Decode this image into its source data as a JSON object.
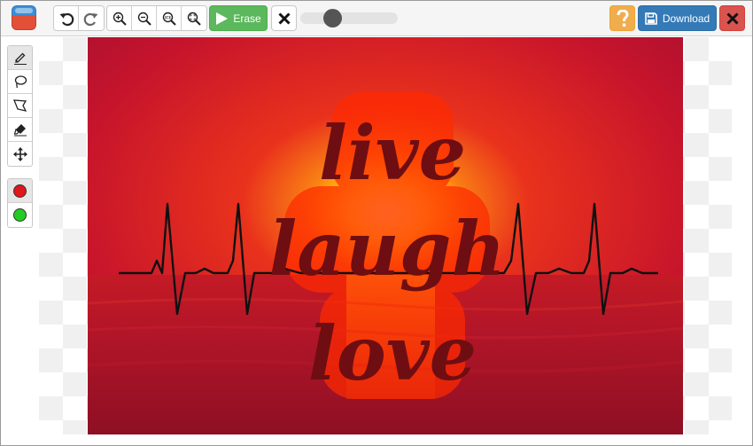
{
  "toolbar": {
    "erase_label": "Erase",
    "download_label": "Download",
    "brush_size": 0.33,
    "buttons": {
      "undo": "undo-icon",
      "redo": "redo-icon",
      "zoom_in": "zoom-in-icon",
      "zoom_out": "zoom-out-icon",
      "zoom_actual": "zoom-actual-size-icon",
      "zoom_fit": "zoom-fit-icon",
      "clear": "close-icon",
      "help": "question-mark-icon",
      "download": "save-icon",
      "close": "close-icon"
    },
    "colors": {
      "erase": "#5cb85c",
      "help": "#f0ad4e",
      "download": "#337ab7",
      "close": "#d9534f"
    }
  },
  "palette": {
    "tools": [
      "marker-icon",
      "lasso-icon",
      "polygon-lasso-icon",
      "eraser-icon",
      "move-icon"
    ],
    "active_tool": "marker-icon",
    "colors": [
      "#e0171b",
      "#22cc22"
    ]
  },
  "canvas": {
    "image_text": [
      "live",
      "laugh",
      "love"
    ],
    "text_color": "#6e0e12",
    "mask_color": "#ff2a00"
  }
}
